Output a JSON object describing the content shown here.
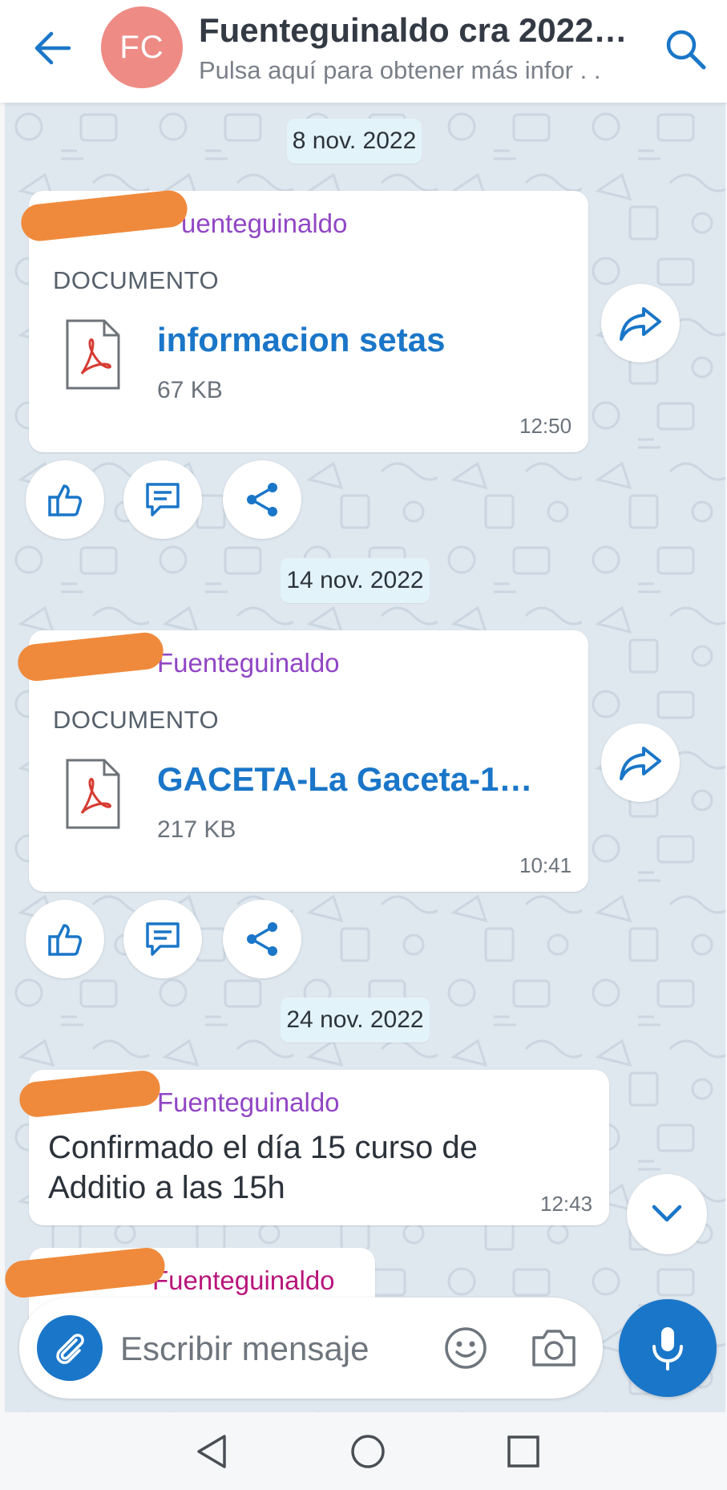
{
  "header": {
    "avatar_initials": "FC",
    "title": "Fuenteguinaldo cra 2022…",
    "subtitle": "Pulsa aquí para obtener más infor . .",
    "icons": {
      "back": "arrow-left-icon",
      "search": "search-icon"
    }
  },
  "messages": [
    {
      "date": "8 nov. 2022",
      "sender": "uenteguinaldo",
      "doc_label": "DOCUMENTO",
      "doc_name": "informacion setas",
      "doc_size": "67 KB",
      "time": "12:50"
    },
    {
      "date": "14 nov. 2022",
      "sender": "Fuenteguinaldo",
      "doc_label": "DOCUMENTO",
      "doc_name": "GACETA-La Gaceta-1…",
      "doc_size": "217 KB",
      "time": "10:41"
    },
    {
      "date": "24 nov. 2022",
      "sender": "Fuenteguinaldo",
      "text_line1": "Confirmado el día 15 curso de",
      "text_line2": "Additio a las 15h",
      "time": "12:43"
    },
    {
      "sender": "Fuenteguinaldo"
    }
  ],
  "composer": {
    "placeholder": "Escribir mensaje",
    "icons": {
      "attach": "paperclip-icon",
      "emoji": "smiley-icon",
      "camera": "camera-icon",
      "mic": "microphone-icon"
    }
  },
  "colors": {
    "accent": "#1a76c8",
    "sender": "#9146c4",
    "avatar": "#ee8b85",
    "date_chip": "#e3f3fa",
    "chat_bg": "#dfe7ef"
  },
  "navbar": {
    "icons": [
      "back-triangle-icon",
      "home-circle-icon",
      "recents-square-icon"
    ]
  }
}
